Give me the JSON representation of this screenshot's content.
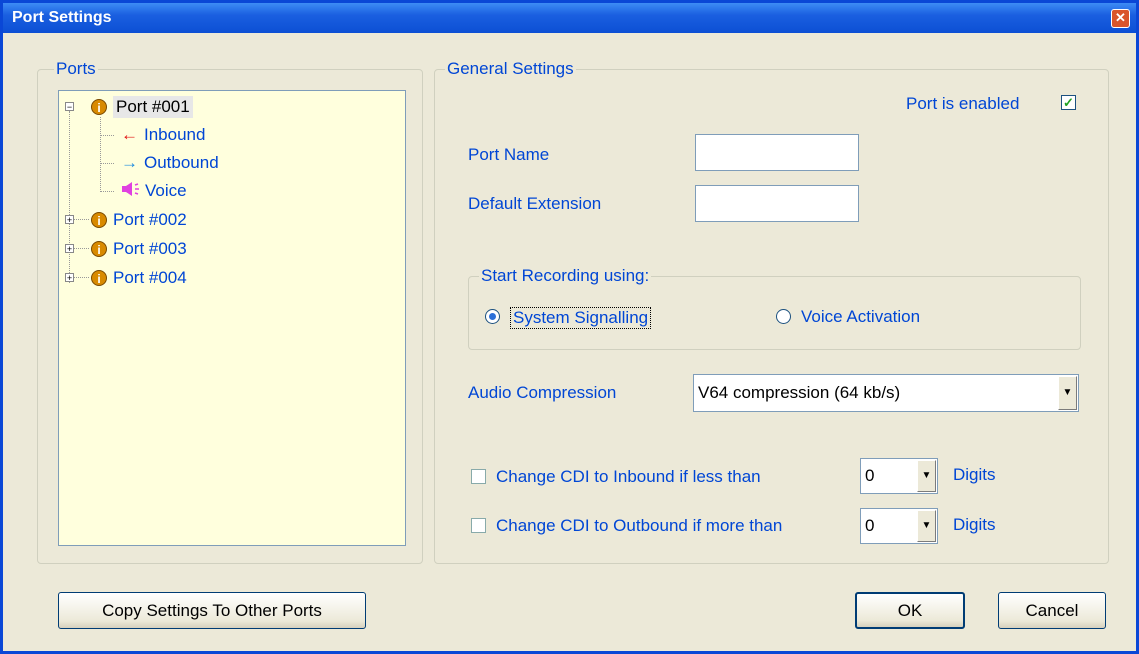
{
  "window": {
    "title": "Port Settings",
    "close_label": "✕"
  },
  "ports": {
    "legend": "Ports",
    "tree": [
      {
        "label": "Port #001",
        "icon": "info-icon",
        "expanded": true,
        "children": [
          {
            "label": "Inbound",
            "icon": "arrow-left-icon",
            "color": "#e01010"
          },
          {
            "label": "Outbound",
            "icon": "arrow-right-icon",
            "color": "#1a8ae0"
          },
          {
            "label": "Voice",
            "icon": "speaker-icon",
            "color": "#e040e0"
          }
        ]
      },
      {
        "label": "Port #002",
        "icon": "info-icon",
        "expanded": false
      },
      {
        "label": "Port #003",
        "icon": "info-icon",
        "expanded": false
      },
      {
        "label": "Port #004",
        "icon": "info-icon",
        "expanded": false
      }
    ],
    "copy_button": "Copy Settings To Other Ports"
  },
  "general": {
    "legend": "General Settings",
    "port_enabled_label": "Port is enabled",
    "port_enabled_checked": true,
    "port_name_label": "Port Name",
    "port_name_value": "",
    "default_ext_label": "Default Extension",
    "default_ext_value": "",
    "start_recording": {
      "legend": "Start Recording using:",
      "option_system": "System Signalling",
      "option_voice": "Voice Activation",
      "selected": "System Signalling"
    },
    "audio_compression_label": "Audio Compression",
    "audio_compression_value": "V64 compression  (64 kb/s)",
    "cdi_inbound_label": "Change CDI to Inbound if less than",
    "cdi_inbound_value": "0",
    "cdi_outbound_label": "Change CDI to Outbound if more than",
    "cdi_outbound_value": "0",
    "digits_label": "Digits"
  },
  "buttons": {
    "ok": "OK",
    "cancel": "Cancel"
  },
  "colors": {
    "accent": "#0046d5",
    "tree_bg": "#ffffdd",
    "dialog_bg": "#ece9d8"
  }
}
